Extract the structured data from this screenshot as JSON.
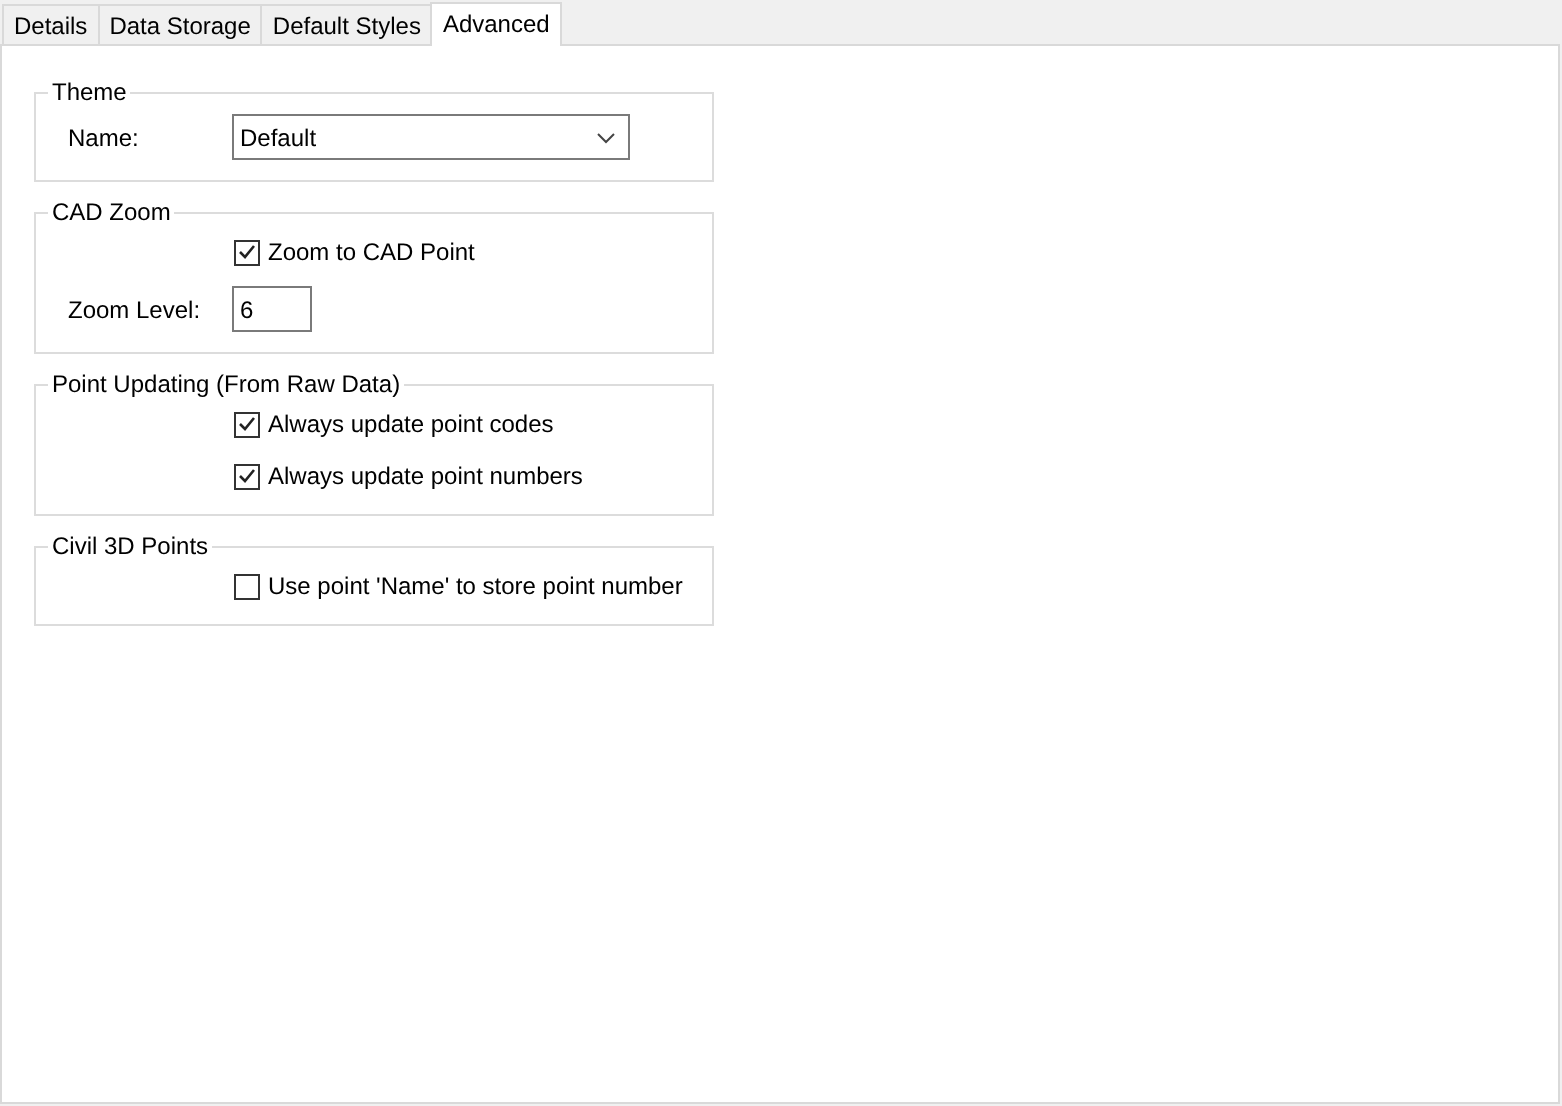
{
  "tabs": [
    {
      "label": "Details",
      "selected": false
    },
    {
      "label": "Data Storage",
      "selected": false
    },
    {
      "label": "Default Styles",
      "selected": false
    },
    {
      "label": "Advanced",
      "selected": true
    }
  ],
  "groups": [
    {
      "title": "Theme",
      "rows": [
        {
          "kind": "dropdown",
          "label": "Name:",
          "value": "Default"
        }
      ]
    },
    {
      "title": "CAD Zoom",
      "rows": [
        {
          "kind": "checkbox",
          "label": "Zoom to CAD Point",
          "checked": true
        },
        {
          "kind": "textbox",
          "label": "Zoom Level:",
          "value": "6"
        }
      ]
    },
    {
      "title": "Point Updating (From Raw Data)",
      "rows": [
        {
          "kind": "checkbox",
          "label": "Always update point codes",
          "checked": true
        },
        {
          "kind": "checkbox",
          "label": "Always update point numbers",
          "checked": true
        }
      ]
    },
    {
      "title": "Civil 3D Points",
      "rows": [
        {
          "kind": "checkbox",
          "label": "Use point 'Name' to store point number",
          "checked": false
        }
      ]
    }
  ]
}
